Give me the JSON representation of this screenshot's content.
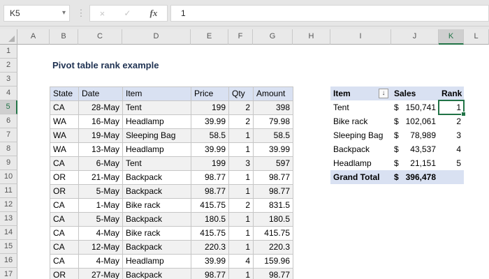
{
  "formula_bar": {
    "name_box": "K5",
    "name_box_arrow": "▾",
    "menu_dots": "⋮",
    "cancel_icon": "×",
    "commit_icon": "✓",
    "fx_icon": "fx",
    "formula": "1"
  },
  "sheet": {
    "title": "Pivot table rank example",
    "selected_cell": "K5",
    "selected_col": "K",
    "selected_row": "5",
    "col_letters": [
      "A",
      "B",
      "C",
      "D",
      "E",
      "F",
      "G",
      "H",
      "I",
      "J",
      "K",
      "L"
    ],
    "row_numbers": [
      "1",
      "2",
      "3",
      "4",
      "5",
      "6",
      "7",
      "8",
      "9",
      "10",
      "11",
      "12",
      "13",
      "14",
      "15",
      "16",
      "17"
    ],
    "main_table": {
      "headers": [
        "State",
        "Date",
        "Item",
        "Price",
        "Qty",
        "Amount"
      ],
      "rows": [
        [
          "CA",
          "28-May",
          "Tent",
          "199",
          "2",
          "398"
        ],
        [
          "WA",
          "16-May",
          "Headlamp",
          "39.99",
          "2",
          "79.98"
        ],
        [
          "WA",
          "19-May",
          "Sleeping Bag",
          "58.5",
          "1",
          "58.5"
        ],
        [
          "WA",
          "13-May",
          "Headlamp",
          "39.99",
          "1",
          "39.99"
        ],
        [
          "CA",
          "6-May",
          "Tent",
          "199",
          "3",
          "597"
        ],
        [
          "OR",
          "21-May",
          "Backpack",
          "98.77",
          "1",
          "98.77"
        ],
        [
          "OR",
          "5-May",
          "Backpack",
          "98.77",
          "1",
          "98.77"
        ],
        [
          "CA",
          "1-May",
          "Bike rack",
          "415.75",
          "2",
          "831.5"
        ],
        [
          "CA",
          "5-May",
          "Backpack",
          "180.5",
          "1",
          "180.5"
        ],
        [
          "CA",
          "4-May",
          "Bike rack",
          "415.75",
          "1",
          "415.75"
        ],
        [
          "CA",
          "12-May",
          "Backpack",
          "220.3",
          "1",
          "220.3"
        ],
        [
          "CA",
          "4-May",
          "Headlamp",
          "39.99",
          "4",
          "159.96"
        ],
        [
          "OR",
          "27-May",
          "Backpack",
          "98.77",
          "1",
          "98.77"
        ]
      ]
    },
    "pivot_table": {
      "headers": [
        "Item",
        "Sales",
        "Rank"
      ],
      "filter_icon": "↓",
      "rows": [
        {
          "item": "Tent",
          "currency": "$",
          "sales": "150,741",
          "rank": "1"
        },
        {
          "item": "Bike rack",
          "currency": "$",
          "sales": "102,061",
          "rank": "2"
        },
        {
          "item": "Sleeping Bag",
          "currency": "$",
          "sales": "78,989",
          "rank": "3"
        },
        {
          "item": "Backpack",
          "currency": "$",
          "sales": "43,537",
          "rank": "4"
        },
        {
          "item": "Headlamp",
          "currency": "$",
          "sales": "21,151",
          "rank": "5"
        }
      ],
      "grand_total": {
        "label": "Grand Total",
        "currency": "$",
        "sales": "396,478",
        "rank": ""
      }
    }
  },
  "colors": {
    "accent_green": "#217346",
    "header_fill": "#D9E1F2",
    "band_fill": "#F1F1F1",
    "title_color": "#1F3252",
    "grid_border": "#C6C6C6"
  }
}
